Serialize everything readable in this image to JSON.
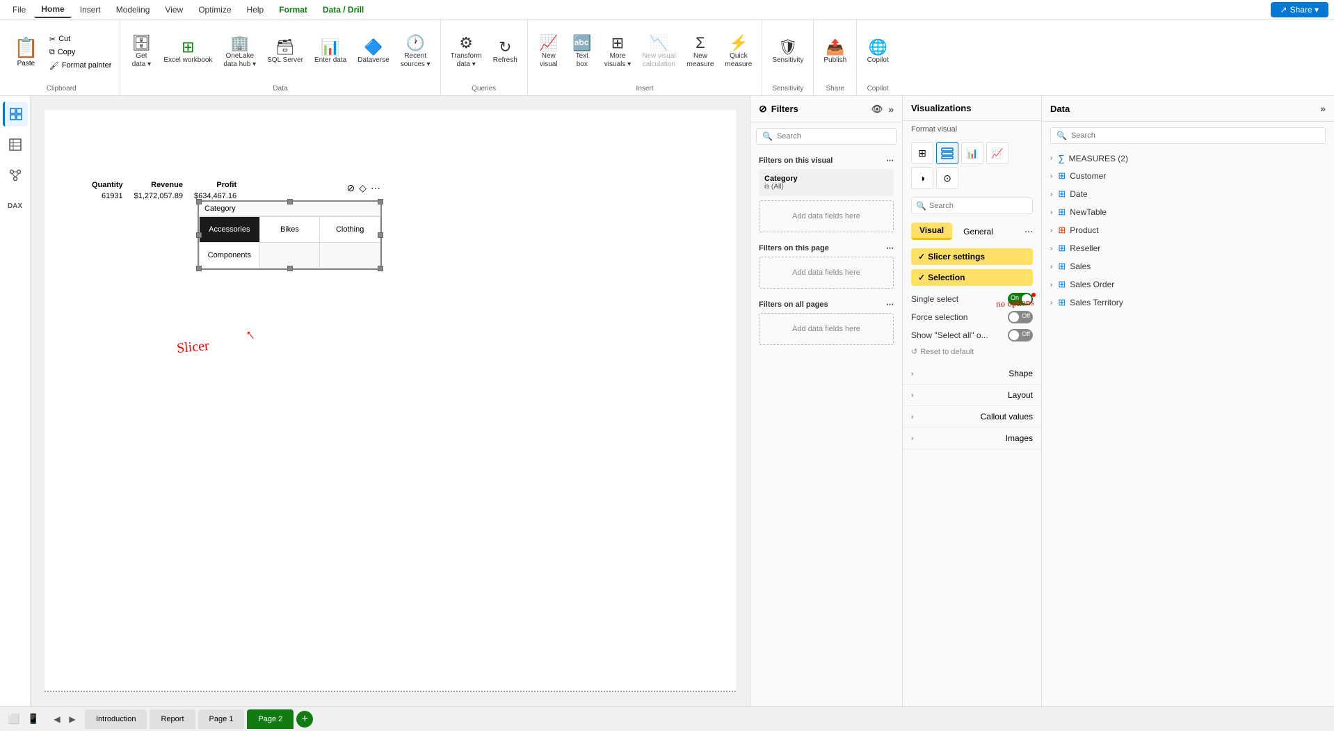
{
  "menu": {
    "items": [
      "File",
      "Home",
      "Insert",
      "Modeling",
      "View",
      "Optimize",
      "Help"
    ],
    "format": "Format",
    "datadrill": "Data / Drill",
    "share": "Share ▾"
  },
  "ribbon": {
    "clipboard": {
      "label": "Clipboard",
      "paste": "Paste",
      "cut": "Cut",
      "copy": "Copy",
      "format_painter": "Format painter"
    },
    "data": {
      "label": "Data",
      "get_data": "Get data",
      "excel": "Excel workbook",
      "onelake": "OneLake data hub",
      "sql_server": "SQL Server",
      "enter_data": "Enter data",
      "dataverse": "Dataverse",
      "recent_sources": "Recent sources"
    },
    "queries": {
      "label": "Queries",
      "transform": "Transform data",
      "refresh": "Refresh"
    },
    "insert": {
      "label": "Insert",
      "new_visual": "New visual",
      "text_box": "Text box",
      "more_visuals": "More visuals",
      "new_visual_calc": "New visual calculation",
      "new_measure": "New measure",
      "quick_measure": "Quick measure"
    },
    "sensitivity": {
      "label": "Sensitivity",
      "sensitivity": "Sensitivity"
    },
    "share_group": {
      "label": "Share",
      "publish": "Publish"
    },
    "copilot": {
      "label": "Copilot",
      "copilot": "Copilot"
    }
  },
  "filters": {
    "title": "Filters",
    "search_placeholder": "Search",
    "on_this_visual": "Filters on this visual",
    "filter_name": "Category",
    "filter_value": "is (All)",
    "add_fields_placeholder": "Add data fields here",
    "on_this_page": "Filters on this page",
    "on_all_pages": "Filters on all pages"
  },
  "visualizations": {
    "title": "Visualizations",
    "format_visual_label": "Format visual",
    "search_placeholder": "Search",
    "visual_tab": "Visual",
    "general_tab": "General",
    "slicer_settings_label": "Slicer settings",
    "selection_label": "Selection",
    "single_select_label": "Single select",
    "force_selection_label": "Force selection",
    "show_select_all_label": "Show \"Select all\" o...",
    "reset_to_default": "Reset to default",
    "shape_label": "Shape",
    "layout_label": "Layout",
    "callout_values_label": "Callout values",
    "images_label": "Images",
    "no_options_annotation": "no options"
  },
  "data_panel": {
    "title": "Data",
    "search_placeholder": "Search",
    "items": [
      {
        "name": "MEASURES (2)",
        "type": "measures"
      },
      {
        "name": "Customer",
        "type": "table"
      },
      {
        "name": "Date",
        "type": "table"
      },
      {
        "name": "NewTable",
        "type": "table"
      },
      {
        "name": "Product",
        "type": "table"
      },
      {
        "name": "Reseller",
        "type": "table"
      },
      {
        "name": "Sales",
        "type": "table"
      },
      {
        "name": "Sales Order",
        "type": "table"
      },
      {
        "name": "Sales Territory",
        "type": "table"
      }
    ]
  },
  "slicer": {
    "header": "Category",
    "items": [
      "Accessories",
      "Bikes",
      "Clothing",
      "Components"
    ]
  },
  "table": {
    "headers": [
      "Quantity",
      "Revenue",
      "Profit"
    ],
    "values": [
      "61931",
      "$1,272,057.89",
      "$634,467.16"
    ]
  },
  "annotations": {
    "slicer_label": "Slicer",
    "arrow": "↗"
  },
  "pages": {
    "tabs": [
      "Introduction",
      "Report",
      "Page 1",
      "Page 2"
    ],
    "active": "Page 2"
  }
}
